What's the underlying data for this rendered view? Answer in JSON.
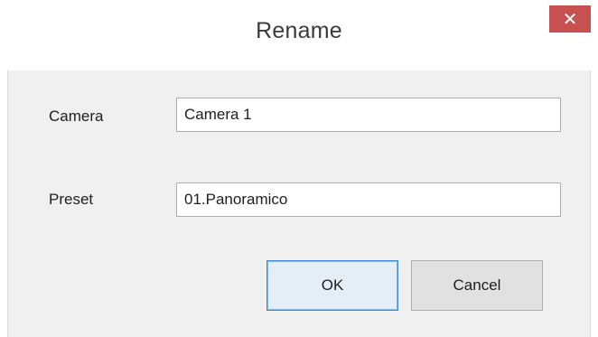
{
  "dialog": {
    "title": "Rename",
    "close_symbol": "✕"
  },
  "form": {
    "camera_label": "Camera",
    "camera_value": "Camera 1",
    "preset_label": "Preset",
    "preset_value": "01.Panoramico"
  },
  "buttons": {
    "ok_label": "OK",
    "cancel_label": "Cancel"
  },
  "colors": {
    "close_button": "#c75050",
    "default_button_border": "#3c8fd8",
    "client_background": "#f0f0f0"
  }
}
